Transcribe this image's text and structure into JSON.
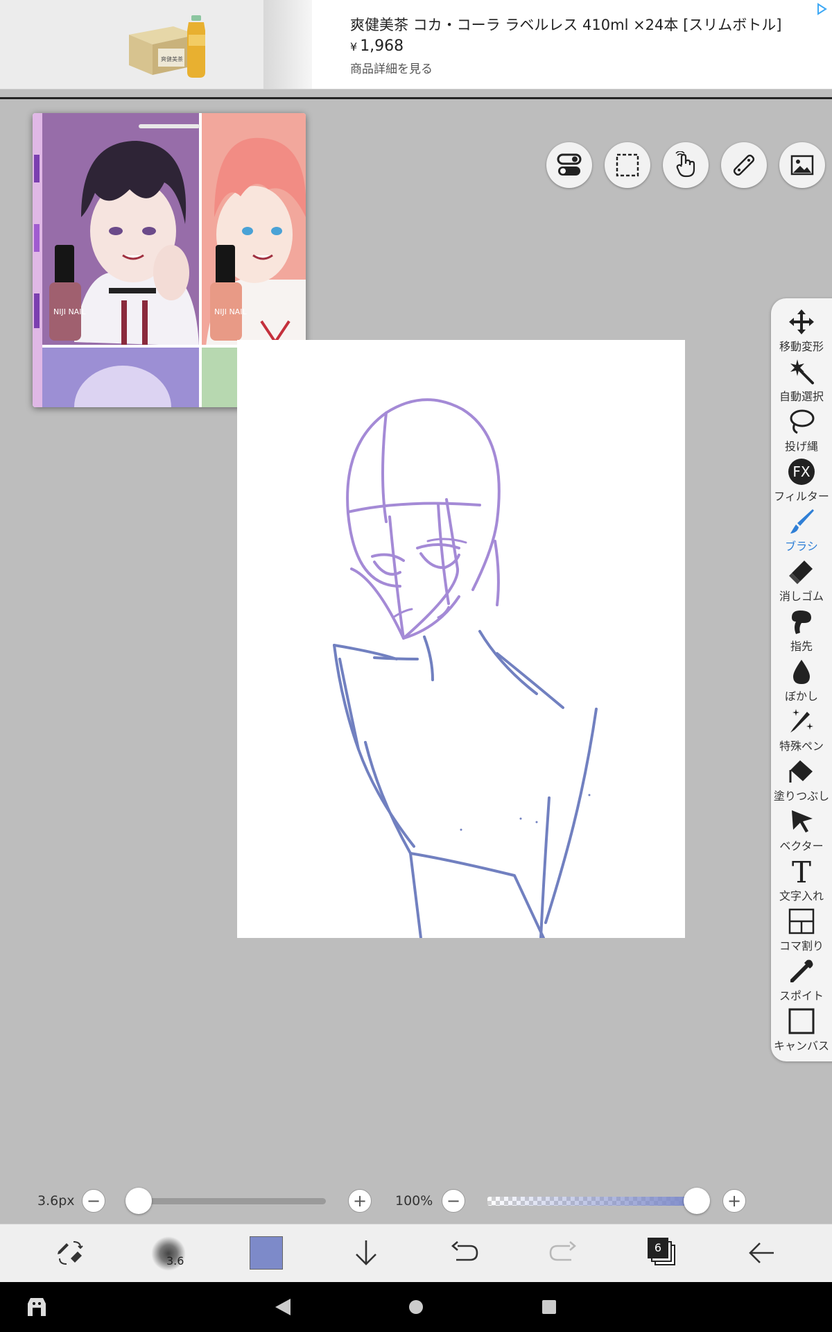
{
  "ad": {
    "title": "爽健美茶 コカ・コーラ ラベルレス 410ml ×24本 [スリムボトル]",
    "price_symbol": "¥",
    "price": "1,968",
    "details_link": "商品詳細を見る",
    "product_box_text": "爽健美茶"
  },
  "top_tools": [
    {
      "icon": "toggle-switch-icon"
    },
    {
      "icon": "selection-rectangle-icon"
    },
    {
      "icon": "hand-touch-icon"
    },
    {
      "icon": "ruler-icon"
    },
    {
      "icon": "image-icon"
    }
  ],
  "reference_image": {
    "bottle_label_1": "NIJI NAIL",
    "bottle_label_2": "NIJI NAIL"
  },
  "right_toolbar": {
    "items": [
      {
        "label": "移動変形",
        "icon": "move-transform-icon"
      },
      {
        "label": "自動選択",
        "icon": "magic-wand-icon"
      },
      {
        "label": "投げ縄",
        "icon": "lasso-icon"
      },
      {
        "label": "フィルター",
        "icon": "filter-fx-icon",
        "icon_text": "FX"
      },
      {
        "label": "ブラシ",
        "icon": "brush-icon",
        "active": true
      },
      {
        "label": "消しゴム",
        "icon": "eraser-icon"
      },
      {
        "label": "指先",
        "icon": "finger-smudge-icon"
      },
      {
        "label": "ぼかし",
        "icon": "blur-drop-icon"
      },
      {
        "label": "特殊ペン",
        "icon": "special-pen-icon"
      },
      {
        "label": "塗りつぶし",
        "icon": "fill-bucket-icon"
      },
      {
        "label": "ベクター",
        "icon": "vector-cursor-icon"
      },
      {
        "label": "文字入れ",
        "icon": "text-icon",
        "icon_text": "T"
      },
      {
        "label": "コマ割り",
        "icon": "frame-divider-icon"
      },
      {
        "label": "スポイト",
        "icon": "eyedropper-icon"
      },
      {
        "label": "キャンバス",
        "icon": "canvas-icon"
      }
    ],
    "active_color": "#2f7fd6"
  },
  "sliders": {
    "brush_size_label": "3.6px",
    "brush_size_value": 3.6,
    "opacity_label": "100%",
    "opacity_value": 100
  },
  "bottom_toolbar": {
    "brush_preview_size": "3.6",
    "current_color": "#7d8ac9",
    "layer_count": "6"
  },
  "colors": {
    "sketch_stroke": "#a48ad6",
    "body_stroke": "#7180c0"
  }
}
